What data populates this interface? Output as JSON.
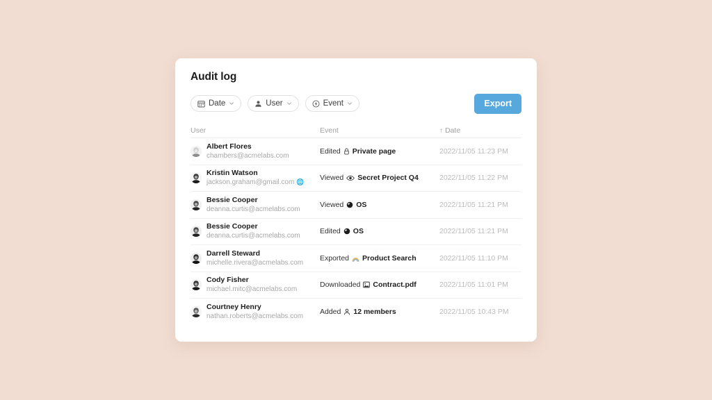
{
  "card": {
    "title": "Audit log"
  },
  "toolbar": {
    "filters": [
      {
        "label": "Date",
        "icon": "calendar-icon"
      },
      {
        "label": "User",
        "icon": "person-icon"
      },
      {
        "label": "Event",
        "icon": "lightning-circle-icon"
      }
    ],
    "export_label": "Export",
    "export_color": "#56a8dd"
  },
  "table": {
    "headers": {
      "user": "User",
      "event": "Event",
      "date": "Date",
      "date_sort": "↑"
    },
    "rows": [
      {
        "name": "Albert Flores",
        "email": "chambers@acmelabs.com",
        "email_emoji": "",
        "avatar": "albert-flores-avatar",
        "verb": "Edited",
        "event_icon": "lock-icon",
        "target": "Private page",
        "date": "2022/11/05 11:23 PM"
      },
      {
        "name": "Kristin Watson",
        "email": "jackson.graham@gmail.com",
        "email_emoji": "🌐",
        "avatar": "kristin-watson-avatar",
        "verb": "Viewed",
        "event_icon": "eye-icon",
        "target": "Secret Project Q4",
        "date": "2022/11/05 11:22 PM"
      },
      {
        "name": "Bessie Cooper",
        "email": "deanna.curtis@acmelabs.com",
        "email_emoji": "",
        "avatar": "bessie-cooper-avatar",
        "verb": "Viewed",
        "event_icon": "sphere-icon",
        "target": "OS",
        "date": "2022/11/05 11:21 PM"
      },
      {
        "name": "Bessie Cooper",
        "email": "deanna.curtis@acmelabs.com",
        "email_emoji": "",
        "avatar": "bessie-cooper-avatar",
        "verb": "Edited",
        "event_icon": "sphere-icon",
        "target": "OS",
        "date": "2022/11/05 11:21 PM"
      },
      {
        "name": "Darrell Steward",
        "email": "michelle.rivera@acmelabs.com",
        "email_emoji": "",
        "avatar": "darrell-steward-avatar",
        "verb": "Exported",
        "event_icon": "rainbow-icon",
        "target": "Product Search",
        "date": "2022/11/05 11:10 PM"
      },
      {
        "name": "Cody Fisher",
        "email": "michael.mitc@acmelabs.com",
        "email_emoji": "",
        "avatar": "cody-fisher-avatar",
        "verb": "Downloaded",
        "event_icon": "picture-icon",
        "target": "Contract.pdf",
        "date": "2022/11/05 11:01 PM"
      },
      {
        "name": "Courtney Henry",
        "email": "nathan.roberts@acmelabs.com",
        "email_emoji": "",
        "avatar": "courtney-henry-avatar",
        "verb": "Added",
        "event_icon": "member-icon",
        "target": "12 members",
        "date": "2022/11/05 10:43 PM"
      }
    ]
  },
  "theme": {
    "page_background": "#f2ddd2",
    "card_background": "#ffffff",
    "accent": "#56a8dd"
  }
}
